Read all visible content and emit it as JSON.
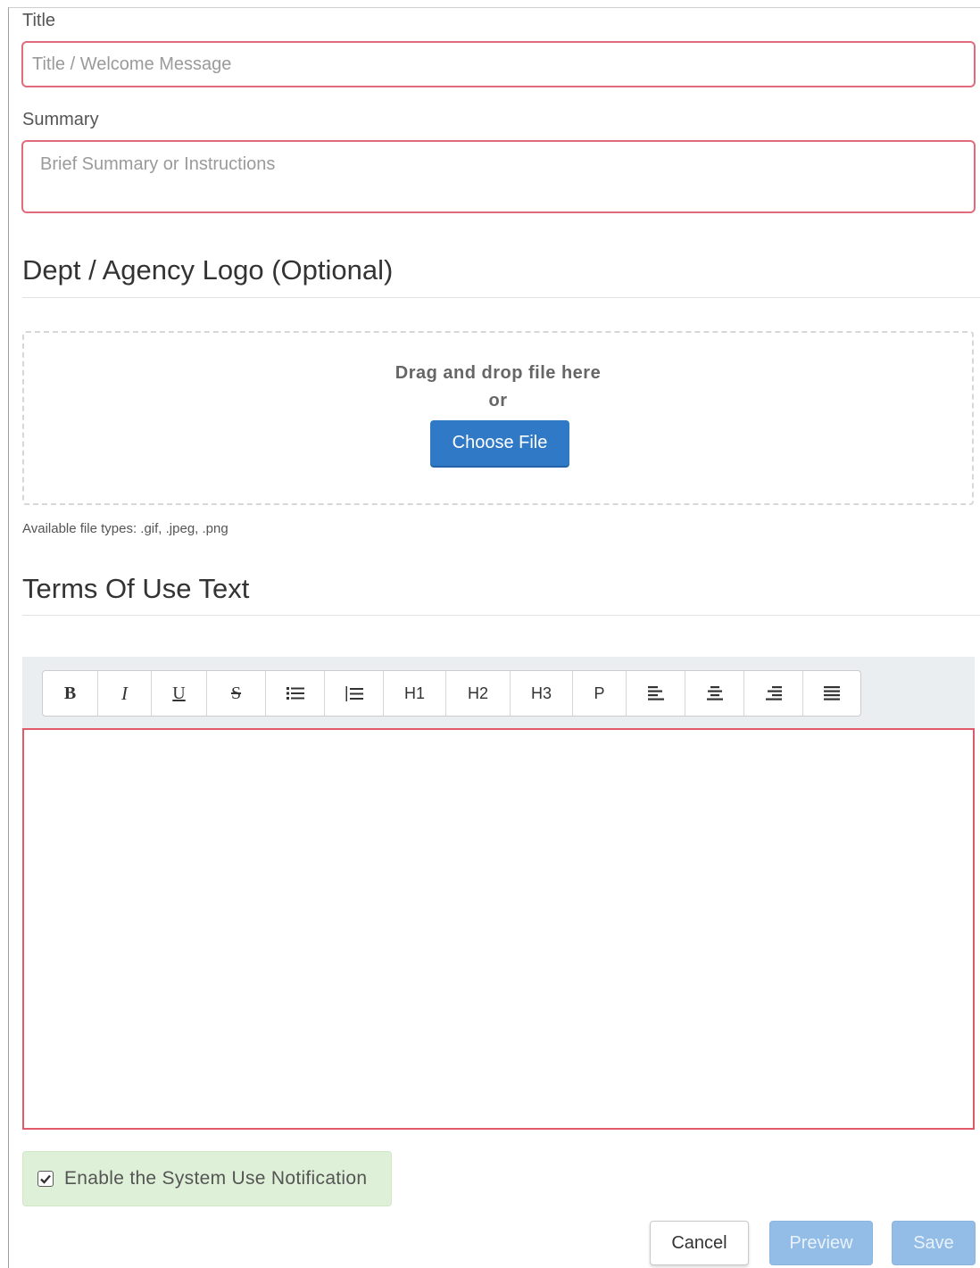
{
  "form": {
    "title_label": "Title",
    "title_placeholder": "Title / Welcome Message",
    "title_value": "",
    "summary_label": "Summary",
    "summary_placeholder": "Brief Summary or Instructions",
    "summary_value": ""
  },
  "logo": {
    "heading": "Dept / Agency Logo (Optional)",
    "drop_text": "Drag and drop file here",
    "or_text": "or",
    "choose_label": "Choose File",
    "file_types_hint": "Available file types: .gif, .jpeg, .png"
  },
  "terms": {
    "heading": "Terms Of Use Text",
    "toolbar": [
      {
        "label": "B",
        "icon": "bold"
      },
      {
        "label": "I",
        "icon": "italic"
      },
      {
        "label": "U",
        "icon": "underline"
      },
      {
        "label": "S",
        "icon": "strikethrough"
      },
      {
        "label": "",
        "icon": "unordered-list-icon"
      },
      {
        "label": "",
        "icon": "ordered-list-icon"
      },
      {
        "label": "H1",
        "icon": "heading-1"
      },
      {
        "label": "H2",
        "icon": "heading-2"
      },
      {
        "label": "H3",
        "icon": "heading-3"
      },
      {
        "label": "P",
        "icon": "paragraph"
      },
      {
        "label": "",
        "icon": "align-left-icon"
      },
      {
        "label": "",
        "icon": "align-center-icon"
      },
      {
        "label": "",
        "icon": "align-right-icon"
      },
      {
        "label": "",
        "icon": "align-justify-icon"
      }
    ],
    "editor_value": ""
  },
  "notification": {
    "checkbox_label": "Enable the System Use Notification",
    "checked": true
  },
  "actions": {
    "cancel_label": "Cancel",
    "preview_label": "Preview",
    "save_label": "Save"
  },
  "colors": {
    "invalid_border": "#e06b7b",
    "primary": "#2f79c7",
    "primary_disabled": "#93bde6",
    "success_bg": "#dff0d8"
  }
}
